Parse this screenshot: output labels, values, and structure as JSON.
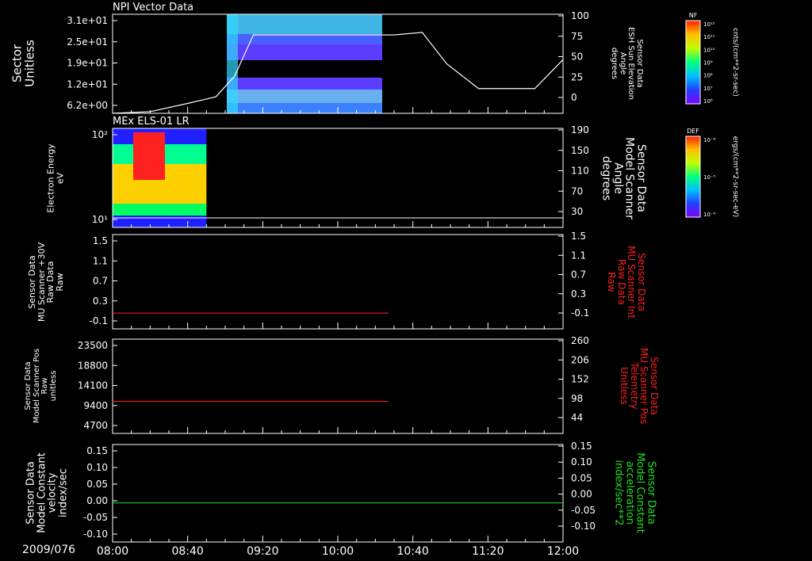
{
  "date_label": "2009/076",
  "time_ticks": [
    "08:00",
    "08:40",
    "09:20",
    "10:00",
    "10:40",
    "11:20",
    "12:00"
  ],
  "colors": {
    "background": "#000000",
    "foreground": "#ffffff",
    "red": "#ff2020",
    "green": "#20e020"
  },
  "panels": [
    {
      "title": "NPI Vector Data",
      "left_label": [
        "Sector",
        "Unitless"
      ],
      "left_ticks": [
        "3.1e+01",
        "2.5e+01",
        "1.9e+01",
        "1.2e+01",
        "6.2e+00"
      ],
      "right_label": [
        "Sensor Data",
        "ESH Sun Elevation",
        "Angle",
        "degrees"
      ],
      "right_ticks": [
        "100",
        "75",
        "50",
        "25",
        "0"
      ]
    },
    {
      "title": "MEx ELS-01 LR",
      "left_label": [
        "Electron Energy",
        "eV"
      ],
      "left_ticks": [
        "10²",
        "10¹"
      ],
      "right_label": [
        "Sensor Data",
        "Model Scanner",
        "Angle",
        "degrees"
      ],
      "right_ticks": [
        "190",
        "150",
        "110",
        "70",
        "30"
      ]
    },
    {
      "title": "",
      "left_label": [
        "Sensor Data",
        "MU Scanner +30V",
        "Raw Data",
        "Raw"
      ],
      "left_ticks": [
        "1.5",
        "1.1",
        "0.7",
        "0.3",
        "-0.1"
      ],
      "right_label": [
        "Sensor Data",
        "MU Scanner Int",
        "Raw Data",
        "Raw"
      ],
      "right_ticks": [
        "1.5",
        "1.1",
        "0.7",
        "0.3",
        "-0.1"
      ]
    },
    {
      "title": "",
      "left_label": [
        "Sensor Data",
        "Model Scanner Pos",
        "Raw",
        "unitless"
      ],
      "left_ticks": [
        "23500",
        "18800",
        "14100",
        "9400",
        "4700"
      ],
      "right_label": [
        "Sensor Data",
        "MU Scanner Pos",
        "Telemetry",
        "Unitless"
      ],
      "right_ticks": [
        "260",
        "206",
        "152",
        "98",
        "44"
      ]
    },
    {
      "title": "",
      "left_label": [
        "Sensor Data",
        "Model Constant",
        "velocity",
        "index/sec"
      ],
      "left_ticks": [
        "0.15",
        "0.10",
        "0.05",
        "0.00",
        "-0.05",
        "-0.10"
      ],
      "right_label": [
        "Sensor Data",
        "Model Constant",
        "acceleration",
        "index/sec**2"
      ],
      "right_ticks": [
        "0.15",
        "0.10",
        "0.05",
        "0.00",
        "-0.05",
        "-0.10"
      ]
    }
  ],
  "colorbars": [
    {
      "tag": "NF",
      "unit": "cnts/(cm**2-sr-sec)",
      "ticks": [
        "10¹²",
        "10¹¹",
        "10¹⁰",
        "10⁹",
        "10⁸",
        "10⁷",
        "10⁶"
      ]
    },
    {
      "tag": "DEF",
      "unit": "ergs/(cm**2-sr-sec-eV)",
      "ticks": [
        "10⁻⁴",
        "10⁻⁵",
        "10⁻⁶"
      ]
    }
  ],
  "chart_data": [
    {
      "type": "line",
      "title": "NPI Vector Data",
      "ylabel": "Sector Unitless",
      "y2label": "Sensor Data ESH Sun Elevation Angle degrees",
      "y2lim": [
        -20,
        100
      ],
      "series": [
        {
          "name": "ESH Sun Elevation Angle",
          "x": [
            "08:00",
            "08:20",
            "08:40",
            "08:55",
            "09:05",
            "09:15",
            "10:30",
            "10:45",
            "10:58",
            "11:15",
            "11:45",
            "12:00"
          ],
          "values": [
            -20,
            -18,
            -8,
            0,
            25,
            75,
            75,
            78,
            40,
            10,
            10,
            45
          ]
        }
      ]
    },
    {
      "type": "heatmap",
      "title": "MEx ELS-01 LR",
      "ylabel": "Electron Energy eV",
      "y2label": "Sensor Data Model Scanner Angle degrees",
      "x_range": [
        "08:00",
        "08:50"
      ],
      "series": [
        {
          "name": "Model Scanner Angle",
          "x": [
            "08:00",
            "12:00"
          ],
          "values": [
            20,
            20
          ]
        }
      ]
    },
    {
      "type": "line",
      "ylabel": "Sensor Data MU Scanner +30V Raw Data Raw",
      "y2label": "Sensor Data MU Scanner Int Raw Data Raw",
      "ylim": [
        -0.3,
        1.5
      ],
      "series": [
        {
          "name": "MU Scanner Int",
          "x": [
            "08:00",
            "10:27"
          ],
          "values": [
            0.0,
            0.0
          ]
        }
      ]
    },
    {
      "type": "line",
      "ylabel": "Sensor Data Model Scanner Pos Raw unitless",
      "y2label": "Sensor Data MU Scanner Pos Telemetry Unitless",
      "ylim": [
        0,
        23500
      ],
      "series": [
        {
          "name": "MU Scanner Pos",
          "x": [
            "08:00",
            "10:27"
          ],
          "values": [
            8000,
            8000
          ]
        }
      ]
    },
    {
      "type": "line",
      "ylabel": "Sensor Data Model Constant velocity index/sec",
      "y2label": "Sensor Data Model Constant acceleration index/sec**2",
      "ylim": [
        -0.1,
        0.15
      ],
      "series": [
        {
          "name": "Model Constant acceleration",
          "x": [
            "08:00",
            "12:00"
          ],
          "values": [
            0.0,
            0.0
          ]
        }
      ]
    }
  ]
}
